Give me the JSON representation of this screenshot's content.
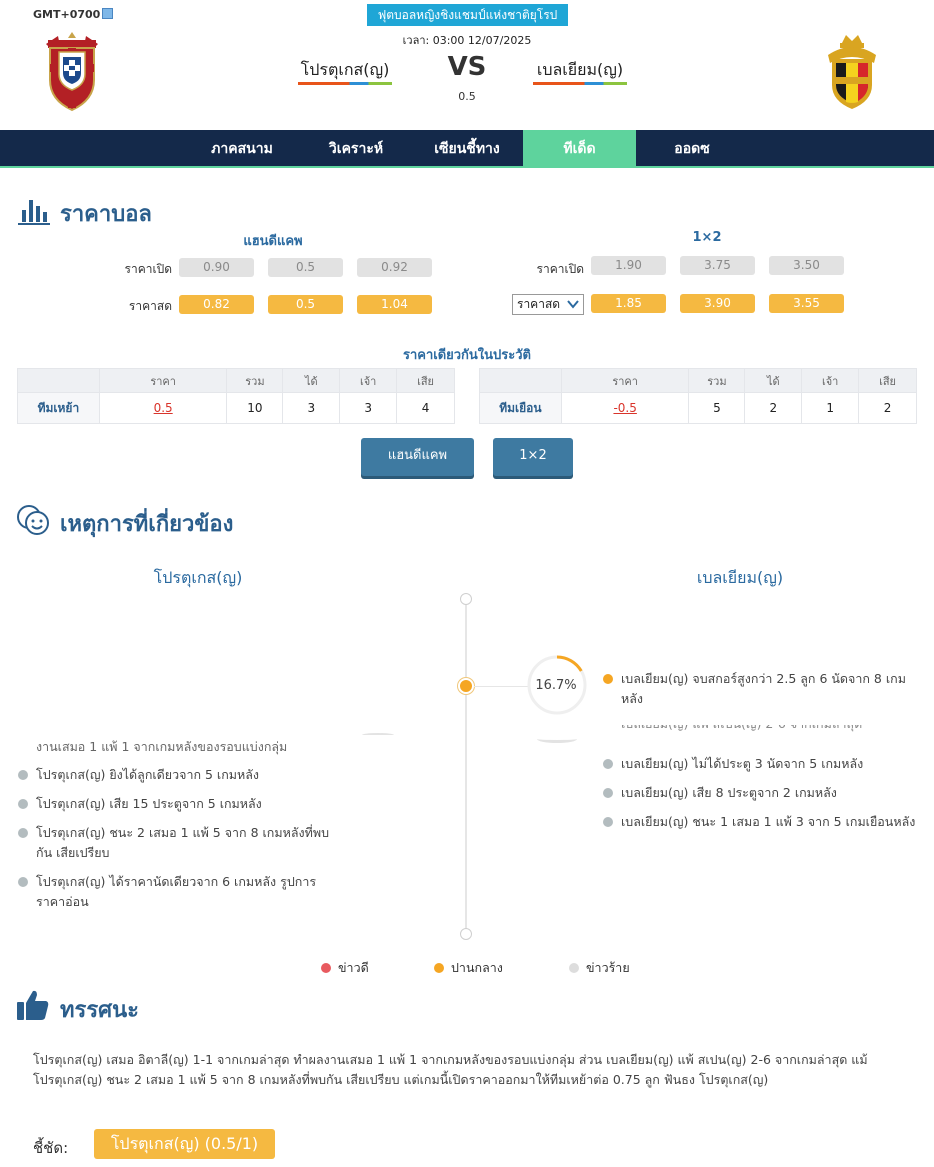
{
  "header": {
    "timezone": "GMT+0700",
    "league": "ฟุตบอลหญิงชิงแชมป์แห่งชาติยุโรป",
    "match_time": "เวลา: 03:00 12/07/2025",
    "home_team": "โปรตุเกส(ญ)",
    "away_team": "เบลเยียม(ญ)",
    "vs": "VS",
    "handicap": "0.5"
  },
  "nav": {
    "items": [
      "ภาคสนาม",
      "วิเคราะห์",
      "เซียนชี้ทาง",
      "ทีเด็ด",
      "ออดซ"
    ],
    "active_index": 3
  },
  "odds": {
    "section_title": "ราคาบอล",
    "handicap": {
      "title": "แฮนดีแคพ",
      "open_label": "ราคาเปิด",
      "live_label": "ราคาสด",
      "open": [
        "0.90",
        "0.5",
        "0.92"
      ],
      "live": [
        "0.82",
        "0.5",
        "1.04"
      ]
    },
    "one_x_two": {
      "title": "1×2",
      "open_label": "ราคาเปิด",
      "select_value": "ราคาสด",
      "open": [
        "1.90",
        "3.75",
        "3.50"
      ],
      "live": [
        "1.85",
        "3.90",
        "3.55"
      ]
    },
    "history_title": "ราคาเดียวกันในประวัติ",
    "columns": [
      "",
      "ราคา",
      "รวม",
      "ได้",
      "เจ้า",
      "เสีย"
    ],
    "history": [
      {
        "team": "ทีมเหย้า",
        "price": "0.5",
        "total": "10",
        "win": "3",
        "draw": "3",
        "lose": "4"
      },
      {
        "team": "ทีมเยือน",
        "price": "-0.5",
        "total": "5",
        "win": "2",
        "draw": "1",
        "lose": "2"
      }
    ],
    "buttons": [
      "แฮนดีแคพ",
      "1×2"
    ]
  },
  "events": {
    "section_title": "เหตุการที่เกี่ยวข้อง",
    "home_team": "โปรตุเกส(ญ)",
    "away_team": "เบลเยียม(ญ)",
    "gauge_percent": 16.7,
    "gauge_label": "16.7%",
    "neutral_color": "#f5a623",
    "good_color": "#e85a5f",
    "bad_color": "#dddddd",
    "away_highlight": "เบลเยียม(ญ) จบสกอร์สูงกว่า 2.5 ลูก 6 นัดจาก 8 เกมหลัง",
    "home_partial": "งานเสมอ 1 แพ้ 1 จากเกมหลังของรอบแบ่งกลุ่ม",
    "away_partial": "เบลเยียม(ญ) แพ้ สเปน(ญ) 2-6 จากเกมล่าสุด",
    "home_events": [
      "โปรตุเกส(ญ) ยิงได้ลูกเดียวจาก 5 เกมหลัง",
      "โปรตุเกส(ญ) เสีย 15 ประตูจาก 5 เกมหลัง",
      "โปรตุเกส(ญ) ชนะ 2 เสมอ 1 แพ้ 5 จาก 8 เกมหลังที่พบกัน เสียเปรียบ",
      "โปรตุเกส(ญ) ได้ราคานัดเดียวจาก 6 เกมหลัง รูปการราคาอ่อน"
    ],
    "away_events": [
      "เบลเยียม(ญ) ไม่ได้ประตู 3 นัดจาก 5 เกมหลัง",
      "เบลเยียม(ญ) เสีย 8 ประตูจาก 2 เกมหลัง",
      "เบลเยียม(ญ) ชนะ 1 เสมอ 1 แพ้ 3 จาก 5 เกมเยือนหลัง"
    ],
    "legend": [
      "ข่าวดี",
      "ปานกลาง",
      "ข่าวร้าย"
    ]
  },
  "opinion": {
    "section_title": "ทรรศนะ",
    "text": "โปรตุเกส(ญ) เสมอ อิตาลี(ญ) 1-1 จากเกมล่าสุด ทำผลงานเสมอ 1 แพ้ 1 จากเกมหลังของรอบแบ่งกลุ่ม ส่วน เบลเยียม(ญ) แพ้ สเปน(ญ) 2-6 จากเกมล่าสุด แม้ โปรตุเกส(ญ) ชนะ 2 เสมอ 1 แพ้ 5 จาก 8 เกมหลังที่พบกัน เสียเปรียบ แต่เกมนี้เปิดราคาออกมาให้ทีมเหย้าต่อ 0.75 ลูก ฟันธง โปรตุเกส(ญ)",
    "pick_label": "ชี้ชัด:",
    "pick_value": "โปรตุเกส(ญ)  (0.5/1)"
  }
}
